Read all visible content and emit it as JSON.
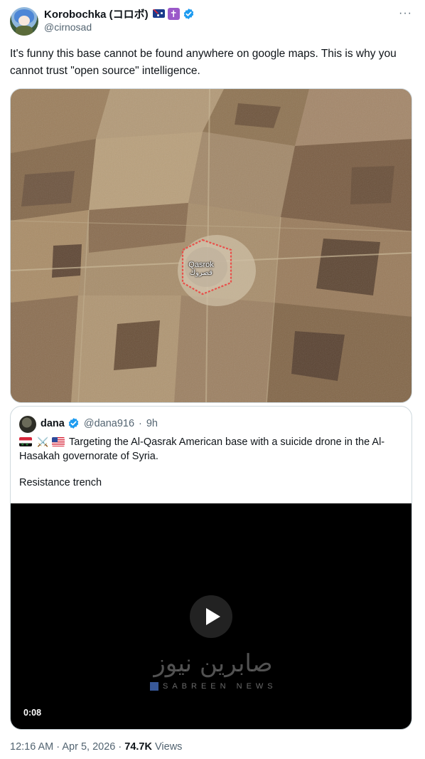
{
  "tweet": {
    "display_name": "Korobochka (コロボ)",
    "badges": [
      "flag-australia-icon",
      "latin-cross-icon",
      "verified-badge-icon"
    ],
    "handle": "@cirnosad",
    "text": "It's funny this base cannot be found anywhere on google maps. This is why you cannot trust \"open source\" intelligence.",
    "more_label": "···"
  },
  "map": {
    "label_en": "Qasrok",
    "label_ar": "قصروك"
  },
  "quote": {
    "display_name": "dana",
    "handle": "@dana916",
    "separator": "·",
    "time": "9h",
    "text": "Targeting the Al-Qasrak American base with a suicide drone in the Al-Hasakah governorate of Syria.",
    "line2": "Resistance trench",
    "emoji_prefix": [
      "flag-syria-icon",
      "crossed-swords-icon",
      "flag-usa-icon"
    ],
    "video": {
      "duration": "0:08",
      "watermark_ar": "صابرين نيوز",
      "watermark_en": "SABREEN NEWS"
    }
  },
  "footer": {
    "time": "12:16 AM",
    "dot1": "·",
    "date": "Apr 5, 2026",
    "dot2": "·",
    "views_count": "74.7K",
    "views_label": "Views"
  },
  "colors": {
    "text_primary": "#0f1419",
    "text_secondary": "#536471",
    "verified_blue": "#1d9bf0",
    "border": "#cfd9de"
  }
}
